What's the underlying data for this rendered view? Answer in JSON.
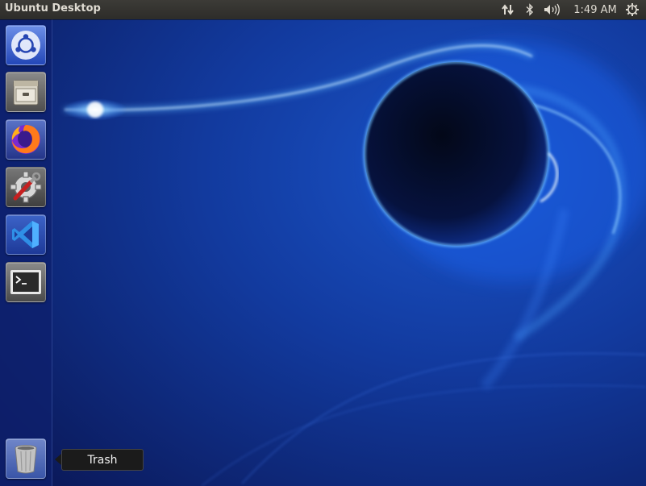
{
  "panel": {
    "title": "Ubuntu Desktop",
    "indicators": {
      "network_icon": "network-updown-icon",
      "bluetooth_icon": "bluetooth-icon",
      "sound_icon": "volume-icon",
      "clock": "1:49 AM",
      "session_icon": "power-gear-icon"
    }
  },
  "launcher": {
    "items": [
      {
        "name": "dash-home",
        "icon": "ubuntu-logo-icon"
      },
      {
        "name": "files",
        "icon": "file-cabinet-icon"
      },
      {
        "name": "firefox",
        "icon": "firefox-icon"
      },
      {
        "name": "system-settings",
        "icon": "settings-wrench-gear-icon"
      },
      {
        "name": "visual-studio-code",
        "icon": "vscode-icon"
      },
      {
        "name": "terminal",
        "icon": "terminal-icon"
      }
    ],
    "trash": {
      "icon": "trash-icon",
      "tooltip": "Trash"
    }
  },
  "colors": {
    "panel_bg": "#3c3b37",
    "wallpaper_dark": "#0a1f6e",
    "wallpaper_glow": "#2f8cff"
  }
}
